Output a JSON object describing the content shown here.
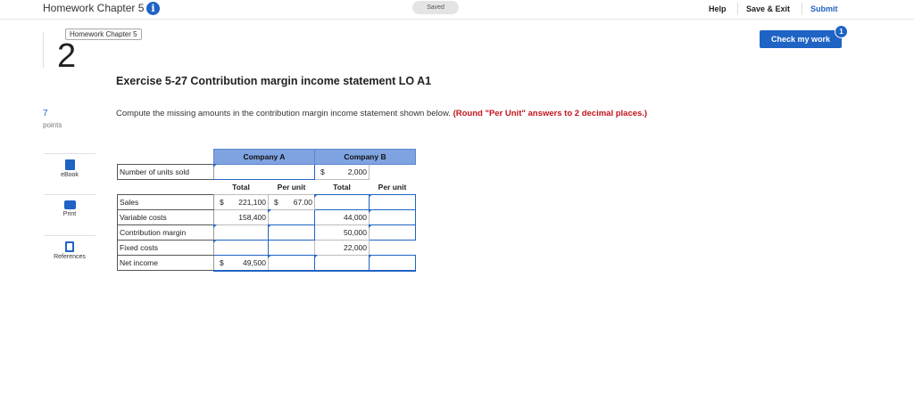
{
  "header": {
    "title": "Homework Chapter 5",
    "info_icon": "i",
    "status": "Saved",
    "help": "Help",
    "save_exit": "Save & Exit",
    "submit": "Submit"
  },
  "check_work": {
    "label": "Check my work",
    "badge": "1"
  },
  "question": {
    "tooltip": "Homework Chapter 5",
    "number": "2",
    "points": "7",
    "points_label": "points"
  },
  "tools": [
    {
      "label": "eBook",
      "icon": "book-icon"
    },
    {
      "label": "Print",
      "icon": "printer-icon"
    },
    {
      "label": "References",
      "icon": "references-icon"
    }
  ],
  "exercise": {
    "title": "Exercise 5-27 Contribution margin income statement LO A1",
    "instruction": "Compute the missing amounts in the contribution margin income statement shown below.",
    "instruction_note": "(Round \"Per Unit\" answers to 2 decimal places.)"
  },
  "table": {
    "company_a": "Company A",
    "company_b": "Company B",
    "units_label": "Number of units sold",
    "units_b_currency": "$",
    "units_b": "2,000",
    "total_header": "Total",
    "per_unit_header": "Per unit",
    "rows": [
      {
        "label": "Sales",
        "a_total_cur": "$",
        "a_total": "221,100",
        "a_unit_cur": "$",
        "a_unit": "67.00",
        "b_total": "",
        "b_unit": ""
      },
      {
        "label": "Variable costs",
        "a_total_cur": "",
        "a_total": "158,400",
        "a_unit_cur": "",
        "a_unit": "",
        "b_total": "44,000",
        "b_unit": ""
      },
      {
        "label": "Contribution margin",
        "a_total_cur": "",
        "a_total": "",
        "a_unit_cur": "",
        "a_unit": "",
        "b_total": "50,000",
        "b_unit": ""
      },
      {
        "label": "Fixed costs",
        "a_total_cur": "",
        "a_total": "",
        "a_unit_cur": "",
        "a_unit": "",
        "b_total": "22,000",
        "b_unit": ""
      },
      {
        "label": "Net income",
        "a_total_cur": "$",
        "a_total": "49,500",
        "a_unit_cur": "",
        "a_unit": "",
        "b_total": "",
        "b_unit": ""
      }
    ]
  }
}
